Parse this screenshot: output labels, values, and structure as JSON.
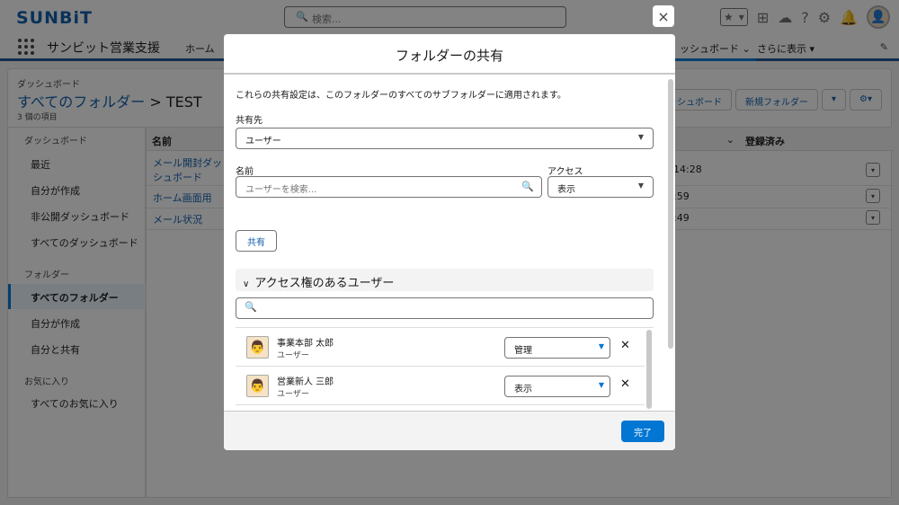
{
  "brand": {
    "logo": "SUNBiT",
    "app_name": "サンビット営業支援"
  },
  "global_search": {
    "placeholder": "検索..."
  },
  "nav": {
    "home": "ホーム",
    "dashboards_tab": "ッシュボード",
    "more": "さらに表示"
  },
  "header": {
    "subtitle": "ダッシュボード",
    "breadcrumb_link": "すべてのフォルダー",
    "separator": ">",
    "current": "TEST",
    "count": "3 個の項目",
    "btn_new_dashboard": "ッシュボード",
    "btn_new_folder": "新規フォルダー"
  },
  "sidebar": {
    "section_dashboards": "ダッシュボード",
    "items_dashboards": [
      "最近",
      "自分が作成",
      "非公開ダッシュボード",
      "すべてのダッシュボード"
    ],
    "section_folders": "フォルダー",
    "items_folders": [
      "すべてのフォルダー",
      "自分が作成",
      "自分と共有"
    ],
    "section_favorites": "お気に入り",
    "items_favorites": [
      "すべてのお気に入り"
    ]
  },
  "table": {
    "col_name": "名前",
    "col_subscribed": "登録済み",
    "rows": [
      {
        "name": "メール開封ダッシュボード",
        "time": "14:28"
      },
      {
        "name": "ホーム画面用",
        "time": ":59"
      },
      {
        "name": "メール状況",
        "time": ":49"
      }
    ]
  },
  "modal": {
    "title": "フォルダーの共有",
    "description": "これらの共有設定は、このフォルダーのすべてのサブフォルダーに適用されます。",
    "share_with_label": "共有先",
    "share_with_value": "ユーザー",
    "name_label": "名前",
    "name_placeholder": "ユーザーを検索...",
    "access_label": "アクセス",
    "access_value": "表示",
    "share_button": "共有",
    "section_title": "アクセス権のあるユーザー",
    "users": [
      {
        "name": "事業本部 太郎",
        "role": "ユーザー",
        "access": "管理"
      },
      {
        "name": "営業新人 三郎",
        "role": "ユーザー",
        "access": "表示"
      }
    ],
    "done_button": "完了"
  },
  "icons": {
    "close": "×",
    "search": "⚲",
    "chevron": "▾"
  },
  "colors": {
    "brand": "#0b5cab",
    "primary": "#0176d3"
  }
}
